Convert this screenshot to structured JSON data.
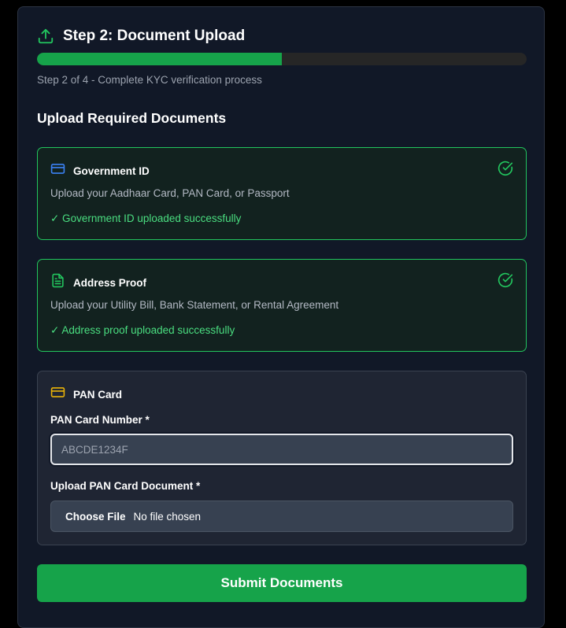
{
  "header": {
    "title": "Step 2: Document Upload",
    "icon": "upload-icon",
    "accent": "#22c55e"
  },
  "progress": {
    "fraction": 0.5,
    "text": "Step 2 of 4 - Complete KYC verification process"
  },
  "section_title": "Upload Required Documents",
  "documents": [
    {
      "title": "Government ID",
      "icon": "credit-card-icon",
      "icon_color": "#3b82f6",
      "description": "Upload your Aadhaar Card, PAN Card, or Passport",
      "status": "✓ Government ID uploaded successfully",
      "complete": true
    },
    {
      "title": "Address Proof",
      "icon": "document-icon",
      "icon_color": "#22c55e",
      "description": "Upload your Utility Bill, Bank Statement, or Rental Agreement",
      "status": "✓ Address proof uploaded successfully",
      "complete": true
    }
  ],
  "pan": {
    "title": "PAN Card",
    "icon": "credit-card-icon",
    "icon_color": "#eab308",
    "number_label": "PAN Card Number *",
    "number_value": "",
    "number_placeholder": "ABCDE1234F",
    "upload_label": "Upload PAN Card Document *",
    "file_button": "Choose File",
    "file_status": "No file chosen"
  },
  "submit_label": "Submit Documents",
  "colors": {
    "success": "#16a34a",
    "background": "#111827"
  }
}
